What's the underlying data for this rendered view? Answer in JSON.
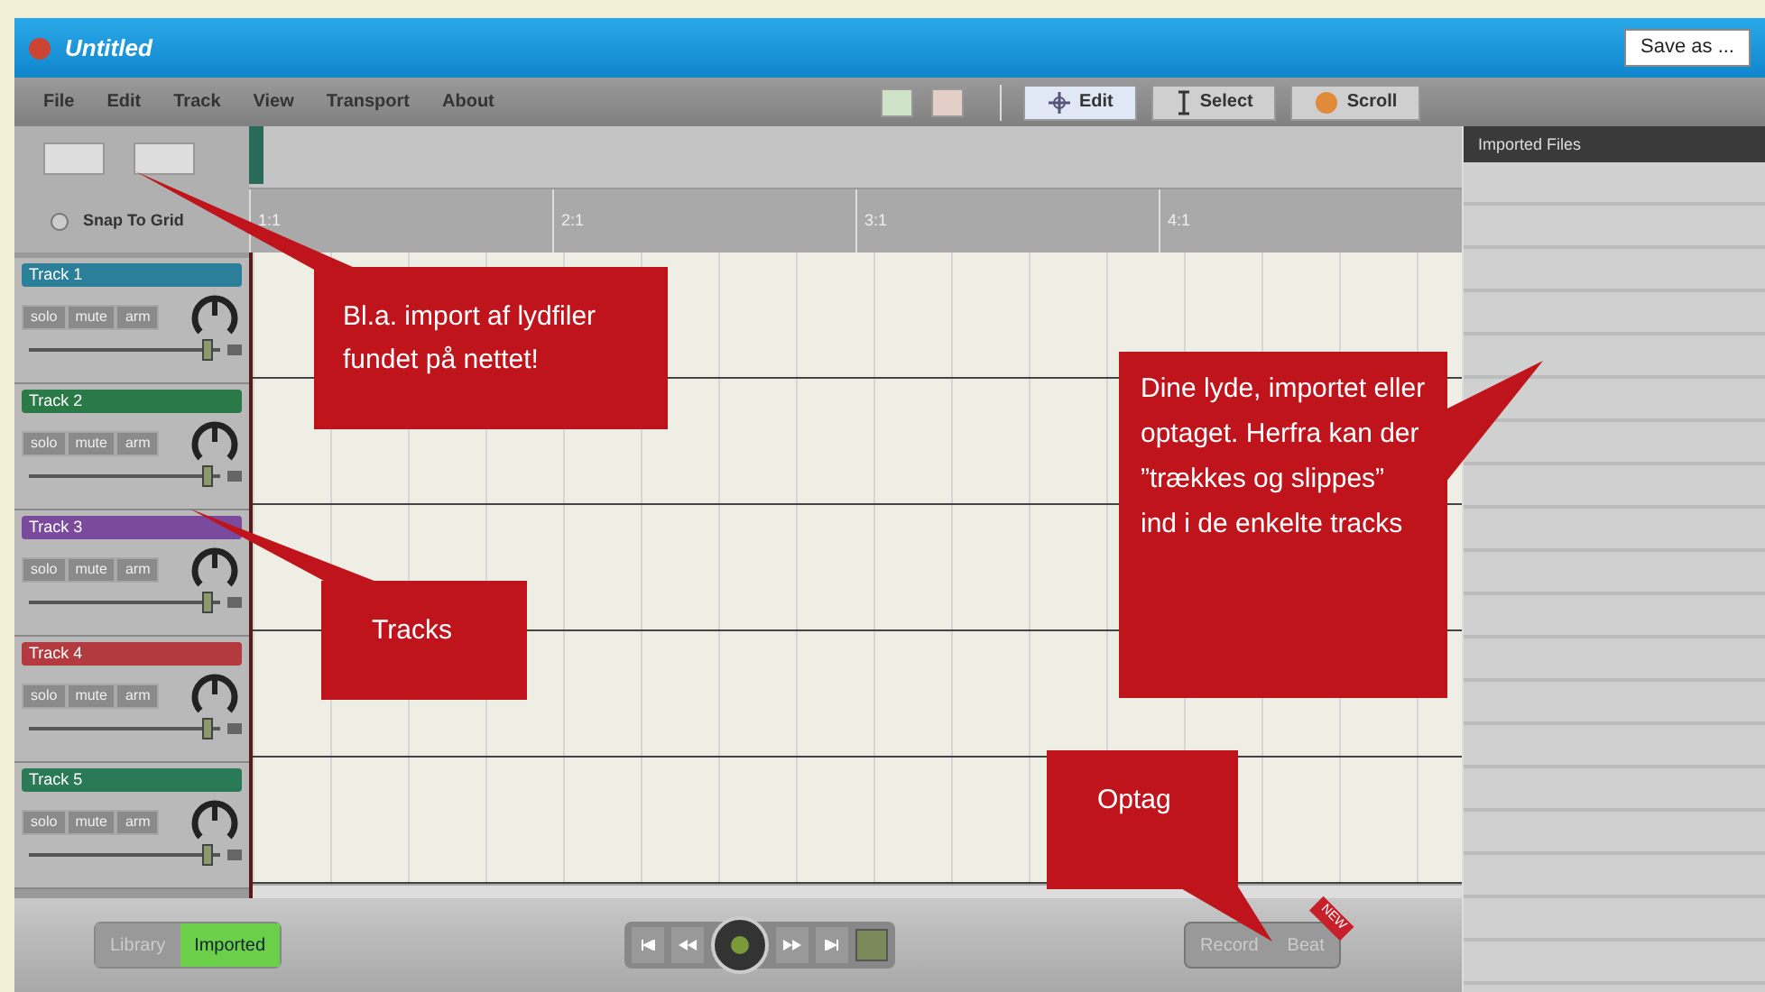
{
  "window": {
    "title": "Untitled",
    "save_button": "Save as ..."
  },
  "menu": [
    "File",
    "Edit",
    "Track",
    "View",
    "Transport",
    "About"
  ],
  "tools": [
    {
      "label": "Edit",
      "kind": "edit",
      "selected": true
    },
    {
      "label": "Select",
      "kind": "select",
      "selected": false
    },
    {
      "label": "Scroll",
      "kind": "scroll",
      "selected": false
    }
  ],
  "snap": {
    "label": "Snap To Grid",
    "checked": false
  },
  "ruler": [
    "1:1",
    "2:1",
    "3:1",
    "4:1"
  ],
  "tracks": [
    {
      "name": "Track 1",
      "color": "#2b7f98",
      "buttons": [
        "solo",
        "mute",
        "arm"
      ],
      "level": 0.93
    },
    {
      "name": "Track 2",
      "color": "#2a7a48",
      "buttons": [
        "solo",
        "mute",
        "arm"
      ],
      "level": 0.93
    },
    {
      "name": "Track 3",
      "color": "#7a4a9c",
      "buttons": [
        "solo",
        "mute",
        "arm"
      ],
      "level": 0.93
    },
    {
      "name": "Track 4",
      "color": "#b33a3e",
      "buttons": [
        "solo",
        "mute",
        "arm"
      ],
      "level": 0.93
    },
    {
      "name": "Track 5",
      "color": "#2a7a58",
      "buttons": [
        "solo",
        "mute",
        "arm"
      ],
      "level": 0.93
    }
  ],
  "files_panel": {
    "title": "Imported Files"
  },
  "source_toggle": [
    {
      "label": "Library",
      "selected": false
    },
    {
      "label": "Imported",
      "selected": true
    }
  ],
  "record_buttons": [
    {
      "label": "Record"
    },
    {
      "label": "Beat",
      "badge": "NEW"
    }
  ],
  "callouts": [
    {
      "text": "Bl.a. import af lydfiler fundet på nettet!",
      "kind": "menu"
    },
    {
      "text": "Tracks",
      "kind": "tracks"
    },
    {
      "text": "Dine lyde, importet eller optaget. Herfra kan der ”trækkes og slippes” ind i de enkelte tracks",
      "kind": "files"
    },
    {
      "text": "Optag",
      "kind": "record"
    }
  ]
}
